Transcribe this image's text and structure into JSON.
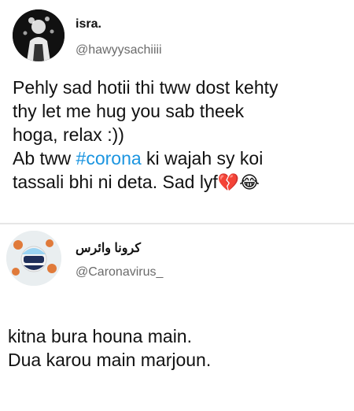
{
  "tweet1": {
    "name": "isra.",
    "handle": "@hawyysachiiii",
    "lines": [
      "Pehly sad hotii thi tww dost kehty",
      "thy let me hug you sab theek",
      "hoga, relax :))"
    ],
    "line4_prefix": "Ab tww ",
    "hashtag": "#corona",
    "line4_suffix": " ki wajah sy koi",
    "line5": "tassali bhi ni deta. Sad lyf",
    "emojis": "💔😂"
  },
  "tweet2": {
    "name": "كرونا وائرس",
    "handle": "@Caronavirus_",
    "lines": [
      "kitna bura houna main.",
      "Dua karou main marjoun."
    ]
  },
  "colors": {
    "hashtag": "#1b95e0",
    "handle": "#6b6b6b"
  }
}
